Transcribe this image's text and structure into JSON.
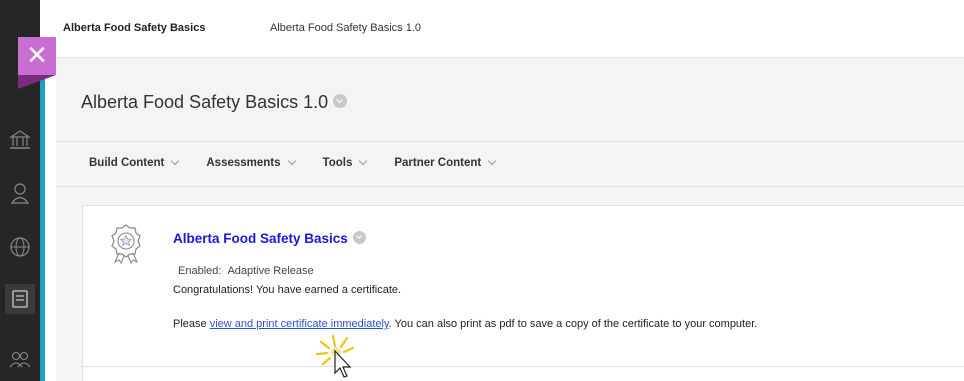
{
  "breadcrumb": {
    "course": "Alberta Food Safety Basics",
    "page": "Alberta Food Safety Basics 1.0"
  },
  "page_title": "Alberta Food Safety Basics 1.0",
  "menu": [
    {
      "label": "Build Content"
    },
    {
      "label": "Assessments"
    },
    {
      "label": "Tools"
    },
    {
      "label": "Partner Content"
    }
  ],
  "item": {
    "title": "Alberta Food Safety Basics",
    "enabled_label": "Enabled:",
    "enabled_value": "Adaptive Release",
    "congrats": "Congratulations! You have earned a certificate.",
    "please_prefix": "Please ",
    "link_text": "view and print certificate immediately",
    "please_suffix": ". You can also print as pdf to save a copy of the certificate to your computer."
  },
  "icons": {
    "close": "close-icon",
    "institution": "institution-icon",
    "profile": "profile-icon",
    "globe": "globe-icon",
    "courses": "courses-icon",
    "groups": "groups-icon",
    "certificate": "award-ribbon-icon",
    "cursor": "mouse-pointer-icon"
  },
  "colors": {
    "rail": "#262626",
    "accent": "#1ba1c4",
    "close_button": "#c86dd1",
    "link": "#1a1ad6"
  }
}
